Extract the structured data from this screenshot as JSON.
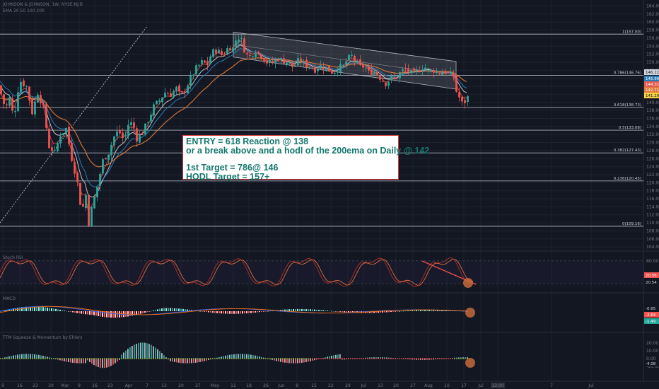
{
  "header": {
    "symbol_line": "JOHNSON & JOHNSON, 1W, NYSE:NJ.B",
    "indicator_line": "EMA 20 50 100 200"
  },
  "annotation": {
    "line1": "ENTRY = 618 Reaction @ 138",
    "line2": "or a break above and a hodl of the 200ema on Daily @ 142",
    "line3": "1st Target = 786@ 146",
    "line4": "HODL Target = 157+"
  },
  "colors": {
    "background": "#131722",
    "up_candle": "#26a69a",
    "down_candle": "#ef5350",
    "fib_line": "#c5cbd6",
    "ema_white": "#d1d4dc",
    "ema_blue": "#2c7bb6",
    "ema_red": "#d0473e",
    "ema_orange": "#e07b39",
    "annotation_text": "#14786e",
    "annotation_border": "#d23c3c",
    "highlight_circle": "#c46a3a"
  },
  "chart_data": [
    {
      "name": "price",
      "type": "candlestick",
      "ylim": [
        103.5,
        165.5
      ],
      "y_ticks": [
        "164.00",
        "162.00",
        "160.00",
        "158.00",
        "156.00",
        "154.00",
        "152.00",
        "150.00",
        "148.00",
        "146.00",
        "144.00",
        "142.00",
        "140.00",
        "138.00",
        "136.00",
        "134.00",
        "132.00",
        "130.00",
        "128.00",
        "126.00",
        "124.00",
        "122.00",
        "120.00",
        "118.00",
        "116.00",
        "114.00",
        "112.00",
        "110.00",
        "108.00",
        "106.00",
        "104.00"
      ],
      "x_labels": [
        {
          "label": "9",
          "i": 4
        },
        {
          "label": "16",
          "i": 28
        },
        {
          "label": "23",
          "i": 50
        },
        {
          "label": "30",
          "i": 72
        },
        {
          "label": "Mar",
          "i": 92
        },
        {
          "label": "9",
          "i": 112
        },
        {
          "label": "16",
          "i": 134
        },
        {
          "label": "23",
          "i": 156
        },
        {
          "label": "Apr",
          "i": 182
        },
        {
          "label": "7",
          "i": 208
        },
        {
          "label": "13",
          "i": 232
        },
        {
          "label": "20",
          "i": 256
        },
        {
          "label": "27",
          "i": 280
        },
        {
          "label": "May",
          "i": 304
        },
        {
          "label": "11",
          "i": 330
        },
        {
          "label": "18",
          "i": 352
        },
        {
          "label": "26",
          "i": 376
        },
        {
          "label": "Jun",
          "i": 398
        },
        {
          "label": "8",
          "i": 420
        },
        {
          "label": "15",
          "i": 444
        },
        {
          "label": "22",
          "i": 468
        },
        {
          "label": "29",
          "i": 492
        },
        {
          "label": "Jul",
          "i": 514
        },
        {
          "label": "13",
          "i": 538
        },
        {
          "label": "20",
          "i": 560
        },
        {
          "label": "27",
          "i": 584
        },
        {
          "label": "Aug",
          "i": 606
        },
        {
          "label": "10",
          "i": 632
        },
        {
          "label": "17",
          "i": 656
        },
        {
          "label": "Jul",
          "i": 680
        },
        {
          "label": "13:00",
          "i": 704
        },
        {
          "label": "7",
          "i": 780
        },
        {
          "label": "Jul",
          "i": 836
        }
      ],
      "key_points": [
        [
          0,
          144.2
        ],
        [
          5,
          141.5
        ],
        [
          10,
          138.5
        ],
        [
          16,
          141.0
        ],
        [
          22,
          136.0
        ],
        [
          30,
          145.5
        ],
        [
          40,
          144.0
        ],
        [
          48,
          137.5
        ],
        [
          56,
          142.5
        ],
        [
          64,
          138.5
        ],
        [
          72,
          129.0
        ],
        [
          80,
          127.5
        ],
        [
          88,
          132.0
        ],
        [
          96,
          133.5
        ],
        [
          104,
          126.0
        ],
        [
          112,
          120.0
        ],
        [
          118,
          112.5
        ],
        [
          124,
          117.0
        ],
        [
          128,
          110.0
        ],
        [
          132,
          113.5
        ],
        [
          140,
          119.0
        ],
        [
          148,
          125.5
        ],
        [
          156,
          127.5
        ],
        [
          164,
          131.5
        ],
        [
          170,
          133.0
        ],
        [
          178,
          130.5
        ],
        [
          184,
          134.5
        ],
        [
          190,
          135.0
        ],
        [
          196,
          131.0
        ],
        [
          204,
          132.5
        ],
        [
          212,
          135.5
        ],
        [
          220,
          139.0
        ],
        [
          228,
          140.5
        ],
        [
          236,
          142.5
        ],
        [
          244,
          142.0
        ],
        [
          252,
          143.5
        ],
        [
          258,
          141.5
        ],
        [
          264,
          143.0
        ],
        [
          272,
          146.0
        ],
        [
          280,
          148.5
        ],
        [
          288,
          150.0
        ],
        [
          296,
          149.5
        ],
        [
          302,
          152.5
        ],
        [
          310,
          153.0
        ],
        [
          318,
          151.5
        ],
        [
          326,
          154.0
        ],
        [
          332,
          153.5
        ],
        [
          338,
          156.5
        ],
        [
          344,
          155.5
        ],
        [
          350,
          152.0
        ],
        [
          356,
          151.5
        ],
        [
          364,
          153.0
        ],
        [
          372,
          151.5
        ],
        [
          380,
          150.0
        ],
        [
          388,
          149.8
        ],
        [
          396,
          151.0
        ],
        [
          402,
          150.4
        ],
        [
          410,
          150.0
        ],
        [
          418,
          148.5
        ],
        [
          424,
          150.3
        ],
        [
          430,
          150.0
        ],
        [
          436,
          149.2
        ],
        [
          442,
          149.0
        ],
        [
          448,
          148.2
        ],
        [
          454,
          149.2
        ],
        [
          460,
          148.8
        ],
        [
          466,
          148.2
        ],
        [
          474,
          147.4
        ],
        [
          482,
          148.8
        ],
        [
          488,
          149.0
        ],
        [
          494,
          150.8
        ],
        [
          500,
          151.5
        ],
        [
          506,
          150.0
        ],
        [
          512,
          148.8
        ],
        [
          518,
          149.0
        ],
        [
          524,
          147.4
        ],
        [
          532,
          147.8
        ],
        [
          540,
          146.2
        ],
        [
          548,
          144.8
        ],
        [
          556,
          146.0
        ],
        [
          562,
          145.8
        ],
        [
          570,
          147.8
        ],
        [
          578,
          148.2
        ],
        [
          586,
          147.0
        ],
        [
          594,
          148.0
        ],
        [
          602,
          149.0
        ],
        [
          610,
          147.8
        ],
        [
          616,
          148.0
        ],
        [
          622,
          147.2
        ],
        [
          630,
          147.8
        ],
        [
          638,
          147.0
        ],
        [
          644,
          146.5
        ],
        [
          646,
          143.5
        ],
        [
          650,
          142.0
        ],
        [
          654,
          140.5
        ],
        [
          658,
          139.0
        ],
        [
          662,
          141.3
        ]
      ],
      "ema_labels": [
        "146.11",
        "145.99",
        "144.31",
        "142.71",
        "141.29"
      ],
      "ema_label_colors": [
        "#d1d4dc",
        "#2c7bb6",
        "#e05d4f",
        "#e07b39",
        "#f5d142"
      ],
      "fib_levels": [
        {
          "label": "1(157.00)",
          "value": 157.0
        },
        {
          "label": "0.786(146.76)",
          "value": 146.76
        },
        {
          "label": "0.618(138.73)",
          "value": 138.73
        },
        {
          "label": "0.5(133.08)",
          "value": 133.08
        },
        {
          "label": "0.382(127.43)",
          "value": 127.43
        },
        {
          "label": "0.236(120.45)",
          "value": 120.45
        },
        {
          "label": "0(109.16)",
          "value": 109.16
        }
      ]
    },
    {
      "name": "stoch_rsi",
      "type": "line",
      "title": "Stoch RSI",
      "values_shown": [
        "20.56",
        "20.54"
      ],
      "y_ticks": [
        "80.00",
        "20.00"
      ]
    },
    {
      "name": "macd",
      "type": "histogram",
      "title": "MACD",
      "values_shown": [
        "-0.65",
        "-2.64",
        "-1.49"
      ]
    },
    {
      "name": "ttm_squeeze",
      "type": "histogram",
      "title": "TTM Squeeze & Momentum by Ehlers",
      "values_shown": [
        "-4.08"
      ],
      "y_ticks": [
        "20.00",
        "10.00",
        "0.00",
        "-10.00"
      ]
    }
  ]
}
